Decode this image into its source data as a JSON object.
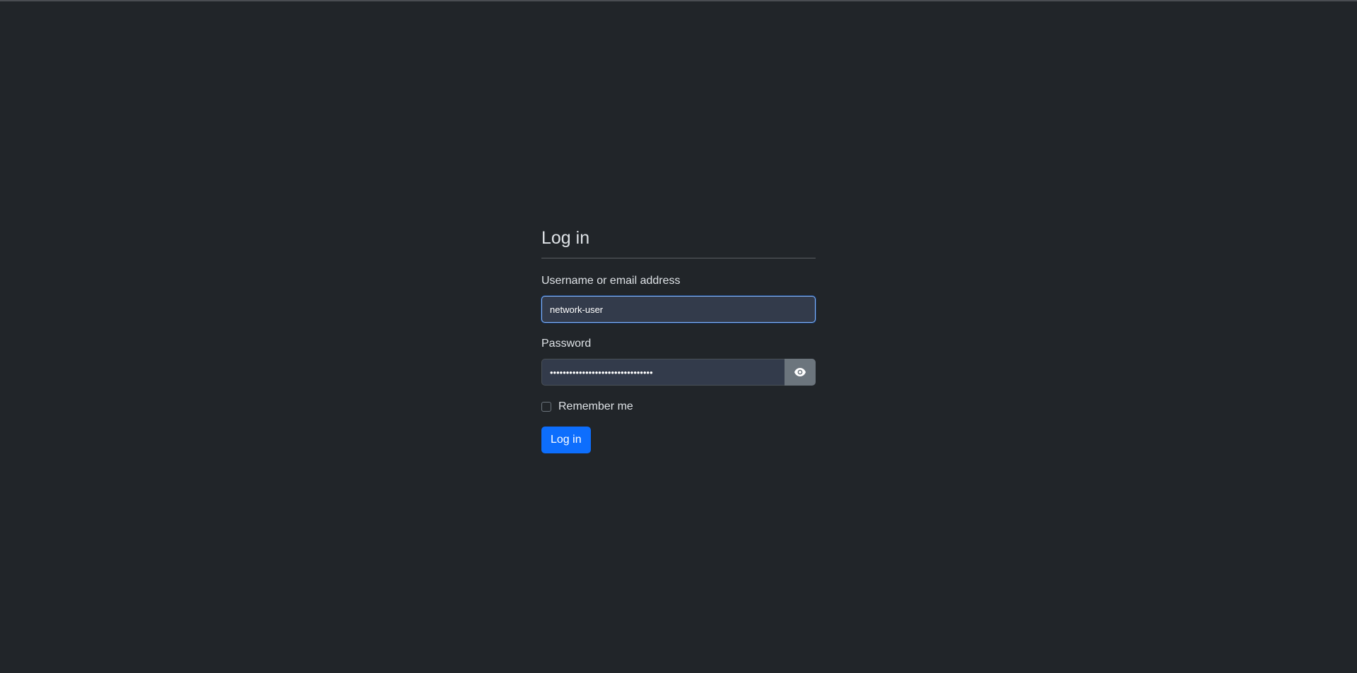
{
  "form": {
    "title": "Log in",
    "username": {
      "label": "Username or email address",
      "value": "network-user"
    },
    "password": {
      "label": "Password",
      "value": "••••••••••••••••••••••••••••••••",
      "toggle_icon": "eye-icon"
    },
    "remember": {
      "label": "Remember me",
      "checked": false
    },
    "submit_label": "Log in"
  },
  "colors": {
    "background": "#212529",
    "input_bg": "#333b4b",
    "primary": "#0d6efd",
    "secondary": "#6c757d",
    "focus_border": "#86b7fe"
  }
}
